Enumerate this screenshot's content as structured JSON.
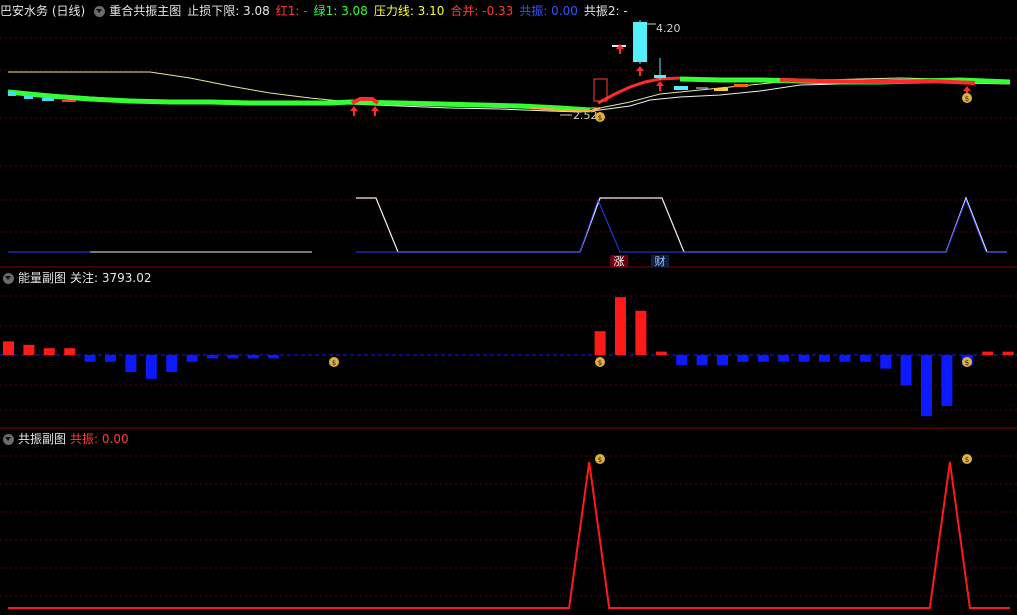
{
  "main_header": {
    "title": "巴安水务 (日线)",
    "indicator": "重合共振主图",
    "items": [
      {
        "label": "止损下限: 3.08",
        "color": "#e6e6e6"
      },
      {
        "label": "红1: -",
        "color": "#ff3b3b"
      },
      {
        "label": "绿1: 3.08",
        "color": "#33ff33"
      },
      {
        "label": "压力线: 3.10",
        "color": "#ffff33"
      },
      {
        "label": "合并: -0.33",
        "color": "#ff3b3b"
      },
      {
        "label": "共振: 0.00",
        "color": "#3355ff"
      },
      {
        "label": "共振2: -",
        "color": "#e6e6e6"
      }
    ]
  },
  "main_chart": {
    "high_label": "4.20",
    "low_label": "2.52",
    "marker_zhang": "涨",
    "marker_cai": "财"
  },
  "energy_header": {
    "title": "能量副图",
    "items": [
      {
        "label": "关注: 3793.02",
        "color": "#e6e6e6"
      }
    ]
  },
  "resonance_header": {
    "title": "共振副图",
    "items": [
      {
        "label": "共振: 0.00",
        "color": "#ff3b3b"
      }
    ]
  },
  "energy_bars": [
    4,
    3,
    2,
    2,
    -2,
    -2,
    -5,
    -7,
    -5,
    -2,
    -1,
    -1,
    -1,
    -1,
    0,
    0,
    0,
    0,
    0,
    0,
    0,
    0,
    0,
    0,
    0,
    0,
    0,
    0,
    0,
    7,
    17,
    13,
    1,
    -3,
    -3,
    -3,
    -2,
    -2,
    -2,
    -2,
    -2,
    -2,
    -2,
    -4,
    -9,
    -18,
    -15,
    -3,
    1,
    1,
    1
  ],
  "resonance_series": [
    0,
    0,
    0,
    0,
    0,
    0,
    0,
    0,
    0,
    0,
    0,
    0,
    0,
    0,
    0,
    0,
    0,
    0,
    0,
    0,
    0,
    0,
    0,
    0,
    0,
    0,
    0,
    0,
    0,
    100,
    0,
    0,
    0,
    0,
    0,
    0,
    0,
    0,
    0,
    0,
    0,
    0,
    0,
    0,
    0,
    0,
    0,
    100,
    0,
    0,
    0
  ],
  "colors": {
    "up": "#ff1a1a",
    "down": "#0d1aff",
    "grid": "#5a0000",
    "divider": "#8a0000"
  }
}
